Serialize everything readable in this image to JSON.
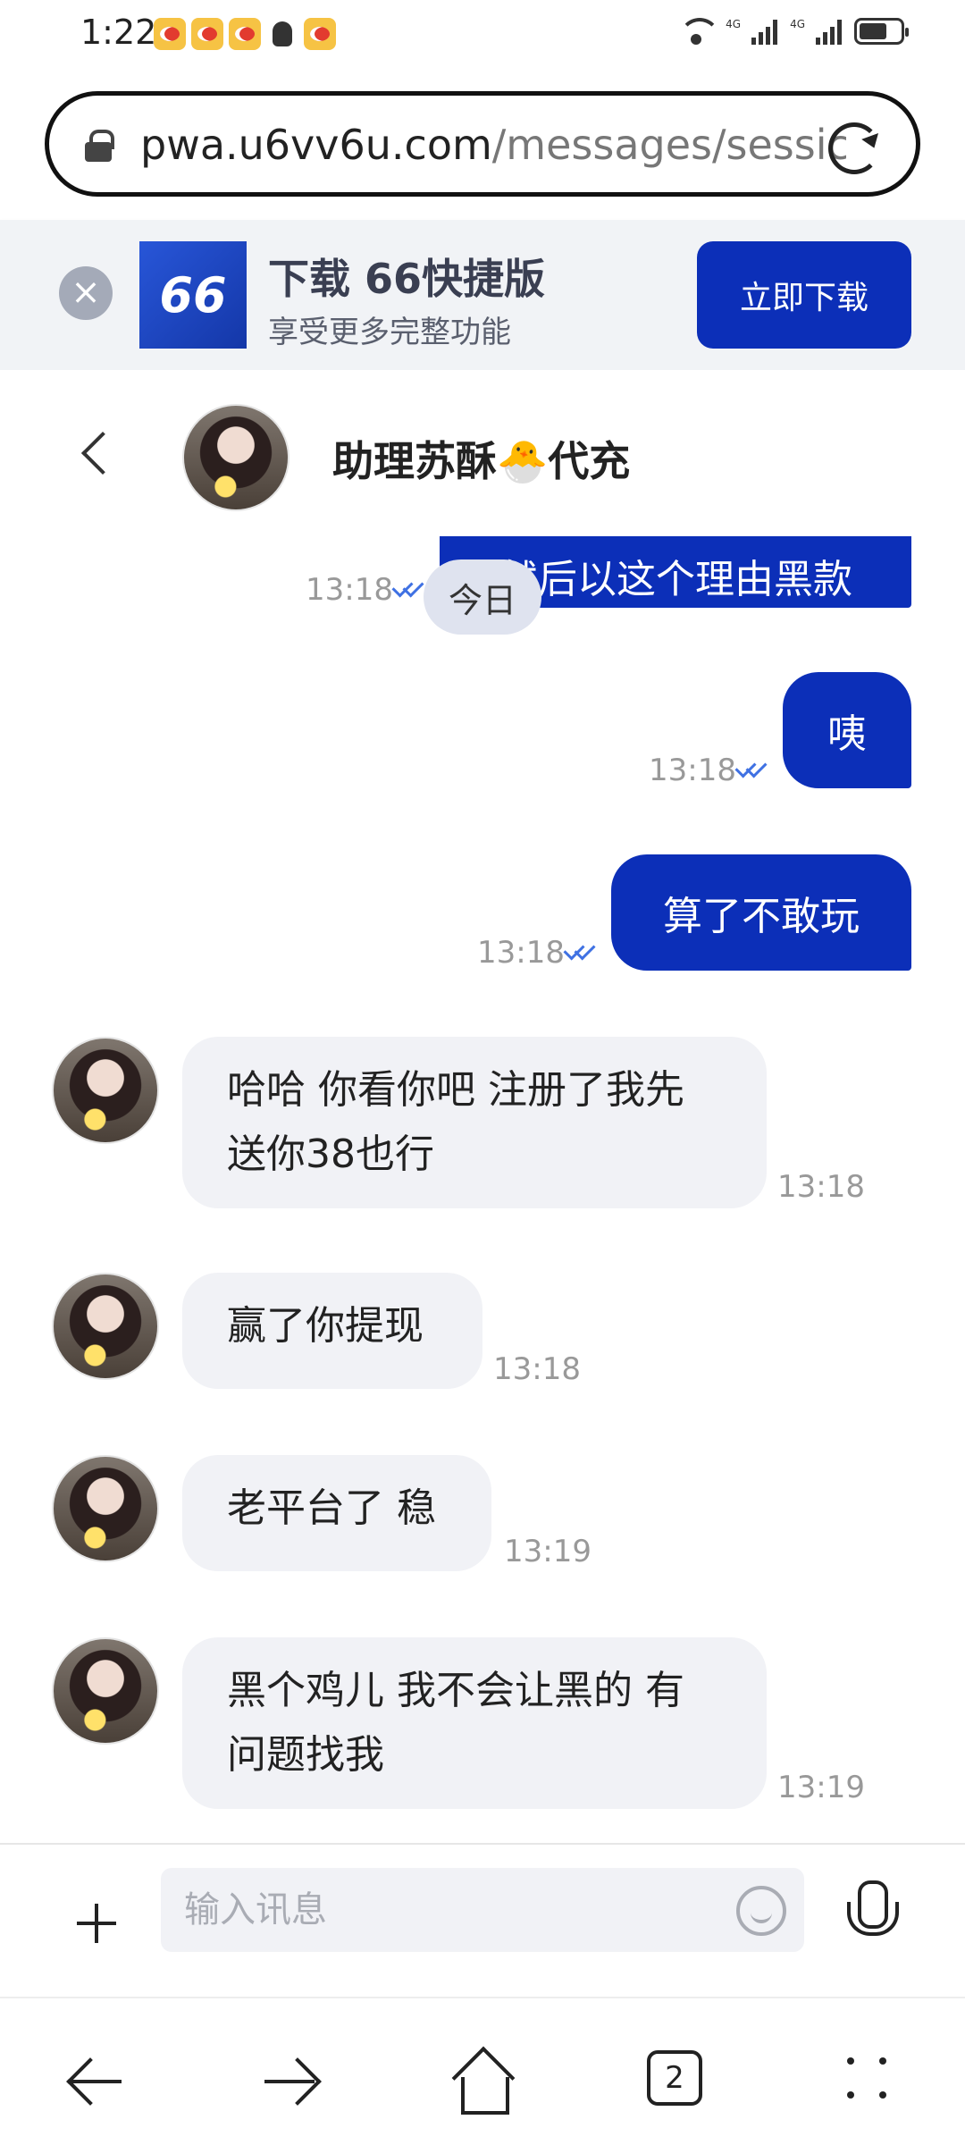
{
  "status_bar": {
    "time": "1:22",
    "network_labels": [
      "4G",
      "4G"
    ]
  },
  "browser": {
    "url_domain": "pwa.u6vv6u.com",
    "url_path": "/messages/sessic"
  },
  "banner": {
    "close_label": "×",
    "logo_text": "66",
    "title": "下载 66快捷版",
    "subtitle": "享受更多完整功能",
    "button_label": "立即下载"
  },
  "chat": {
    "contact_name": "助理苏酥🐣代充",
    "date_label": "今日",
    "partial_message": "然后以这个理由黑款",
    "partial_time": "13:18",
    "messages": [
      {
        "side": "out",
        "text": "咦",
        "time": "13:18"
      },
      {
        "side": "out",
        "text": "算了不敢玩",
        "time": "13:18"
      },
      {
        "side": "in",
        "lines": [
          "哈哈 你看你吧 注册了我先",
          "送你38也行"
        ],
        "time": "13:18"
      },
      {
        "side": "in",
        "lines": [
          "赢了你提现"
        ],
        "time": "13:18"
      },
      {
        "side": "in",
        "lines": [
          "老平台了 稳"
        ],
        "time": "13:19"
      },
      {
        "side": "in",
        "lines": [
          "黑个鸡儿 我不会让黑的 有",
          "问题找我"
        ],
        "time": "13:19"
      }
    ]
  },
  "composer": {
    "placeholder": "输入讯息"
  },
  "nav": {
    "tab_count": "2"
  }
}
